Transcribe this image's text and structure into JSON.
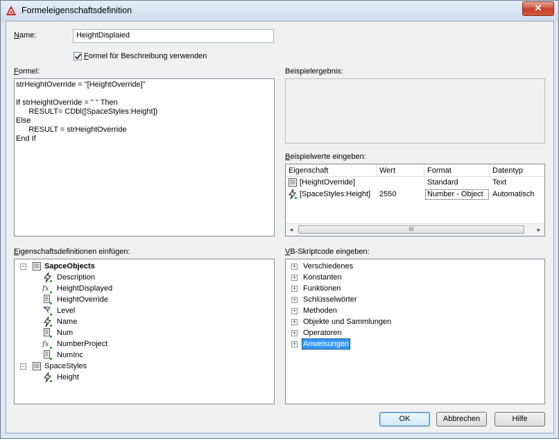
{
  "window": {
    "title": "Formeleigenschaftsdefinition",
    "close_label": "✕"
  },
  "name_field": {
    "label": "Name:",
    "value": "HeightDisplaied"
  },
  "use_formula_checkbox": {
    "label": "Formel für Beschreibung verwenden",
    "checked": true
  },
  "formula": {
    "label": "Formel:",
    "lines": [
      "strHeightOverride = \"[HeightOverride]\"",
      "",
      "If strHeightOverride = \" \" Then",
      "      RESULT= CDbl([SpaceStyles:Height])",
      "Else",
      "      RESULT = strHeightOverride",
      "End If"
    ]
  },
  "sample_result": {
    "label": "Beispielergebnis:"
  },
  "sample_values": {
    "label": "Beispielwerte eingeben:",
    "columns": [
      "Eigenschaft",
      "Wert",
      "Format",
      "Datentyp"
    ],
    "rows": [
      {
        "icon": "property-set-icon",
        "property": "[HeightOverride]",
        "value": "",
        "format": "Standard",
        "datatype": "Text"
      },
      {
        "icon": "automatic-property-icon",
        "property": "[SpaceStyles:Height]",
        "value": "2550",
        "format": "Number - Object",
        "datatype": "Automatisch"
      }
    ],
    "scroll_thumb_grip": "III"
  },
  "insert_definitions": {
    "label": "Eigenschaftsdefinitionen einfügen:",
    "tree": [
      {
        "label": "SapceObjects",
        "icon": "property-set-icon",
        "bold": true,
        "expander": "−",
        "children": [
          {
            "label": "Description",
            "icon": "automatic-property-icon"
          },
          {
            "label": "HeightDisplayed",
            "icon": "formula-icon"
          },
          {
            "label": "HeightOverride",
            "icon": "manual-property-icon"
          },
          {
            "label": "Level",
            "icon": "location-property-icon"
          },
          {
            "label": "Name",
            "icon": "automatic-property-icon"
          },
          {
            "label": "Num",
            "icon": "manual-property-icon"
          },
          {
            "label": "NumberProject",
            "icon": "formula-icon"
          },
          {
            "label": "NumInc",
            "icon": "manual-property-icon"
          }
        ]
      },
      {
        "label": "SpaceStyles",
        "icon": "property-set-icon",
        "bold": false,
        "expander": "−",
        "children": [
          {
            "label": "Height",
            "icon": "automatic-property-icon"
          }
        ]
      }
    ]
  },
  "vb_script": {
    "label": "VB-Skriptcode eingeben:",
    "items": [
      "Verschiedenes",
      "Konstanten",
      "Funktionen",
      "Schlüsselwörter",
      "Methoden",
      "Objekte und Sammlungen",
      "Operatoren",
      "Anweisungen"
    ],
    "selected_index": 7,
    "expander": "+"
  },
  "buttons": {
    "ok": "OK",
    "cancel": "Abbrechen",
    "help": "Hilfe"
  },
  "colors": {
    "selection_bg": "#3399ff",
    "add_plus": "#22a022",
    "lightning": "#2a2a2a"
  }
}
